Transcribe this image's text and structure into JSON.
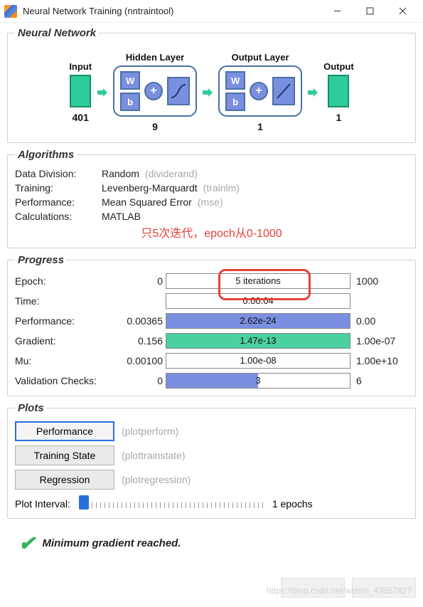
{
  "titlebar": {
    "title": "Neural Network Training (nntraintool)"
  },
  "nn": {
    "section": "Neural Network",
    "input_label": "Input",
    "hidden_label": "Hidden Layer",
    "output_label": "Output Layer",
    "result_label": "Output",
    "input_size": "401",
    "hidden_size": "9",
    "output_size": "1",
    "result_size": "1"
  },
  "algorithms": {
    "section": "Algorithms",
    "rows": [
      {
        "label": "Data Division:",
        "value": "Random",
        "sub": "(dividerand)"
      },
      {
        "label": "Training:",
        "value": "Levenberg-Marquardt",
        "sub": "(trainlm)"
      },
      {
        "label": "Performance:",
        "value": "Mean Squared Error",
        "sub": "(mse)"
      },
      {
        "label": "Calculations:",
        "value": "MATLAB",
        "sub": ""
      }
    ],
    "annotation": "只5次迭代，epoch从0-1000"
  },
  "progress": {
    "section": "Progress",
    "rows": [
      {
        "label": "Epoch:",
        "left": "0",
        "text": "5 iterations",
        "right": "1000",
        "fill": 0,
        "color": "blue"
      },
      {
        "label": "Time:",
        "left": "",
        "text": "0:00:04",
        "right": "",
        "fill": 0,
        "color": "blue"
      },
      {
        "label": "Performance:",
        "left": "0.00365",
        "text": "2.62e-24",
        "right": "0.00",
        "fill": 100,
        "color": "blue"
      },
      {
        "label": "Gradient:",
        "left": "0.156",
        "text": "1.47e-13",
        "right": "1.00e-07",
        "fill": 100,
        "color": "green"
      },
      {
        "label": "Mu:",
        "left": "0.00100",
        "text": "1.00e-08",
        "right": "1.00e+10",
        "fill": 0,
        "color": "blue"
      },
      {
        "label": "Validation Checks:",
        "left": "0",
        "text": "3",
        "right": "6",
        "fill": 50,
        "color": "blue"
      }
    ]
  },
  "plots": {
    "section": "Plots",
    "buttons": [
      {
        "label": "Performance",
        "sub": "(plotperform)",
        "active": true
      },
      {
        "label": "Training State",
        "sub": "(plottrainstate)",
        "active": false
      },
      {
        "label": "Regression",
        "sub": "(plotregression)",
        "active": false
      }
    ],
    "interval_label": "Plot Interval:",
    "interval_value": "1 epochs"
  },
  "status": {
    "message": "Minimum gradient reached."
  },
  "footer": {
    "watermark": "https://blog.csdn.net/weixin_43857827"
  }
}
